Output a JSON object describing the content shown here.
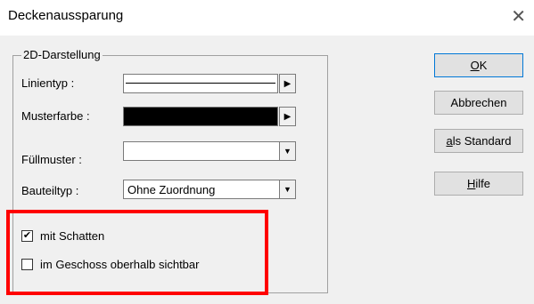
{
  "window": {
    "title": "Deckenaussparung",
    "close_glyph": "✕"
  },
  "group": {
    "legend": "2D-Darstellung",
    "rows": {
      "linientyp": {
        "label": "Linientyp :"
      },
      "musterfarbe": {
        "label": "Musterfarbe :",
        "color": "#000000"
      },
      "fuellmuster": {
        "label": "Füllmuster :",
        "value": ""
      },
      "bauteiltyp": {
        "label": "Bauteiltyp :",
        "value": "Ohne Zuordnung"
      }
    }
  },
  "checkboxes": {
    "schatten": {
      "label": "mit Schatten",
      "checked": true
    },
    "geschoss": {
      "label": "im Geschoss oberhalb sichtbar",
      "checked": false
    }
  },
  "buttons": {
    "ok": {
      "mnemonic": "O",
      "rest": "K"
    },
    "abbrechen": {
      "label": "Abbrechen"
    },
    "standard": {
      "mnemonic": "a",
      "rest": "ls Standard"
    },
    "hilfe": {
      "mnemonic": "H",
      "rest": "ilfe"
    }
  },
  "icons": {
    "arrow_right": "▶",
    "dropdown": "▼",
    "check": "✔"
  },
  "colors": {
    "highlight": "#ff0000",
    "default_button_border": "#0078d7"
  }
}
